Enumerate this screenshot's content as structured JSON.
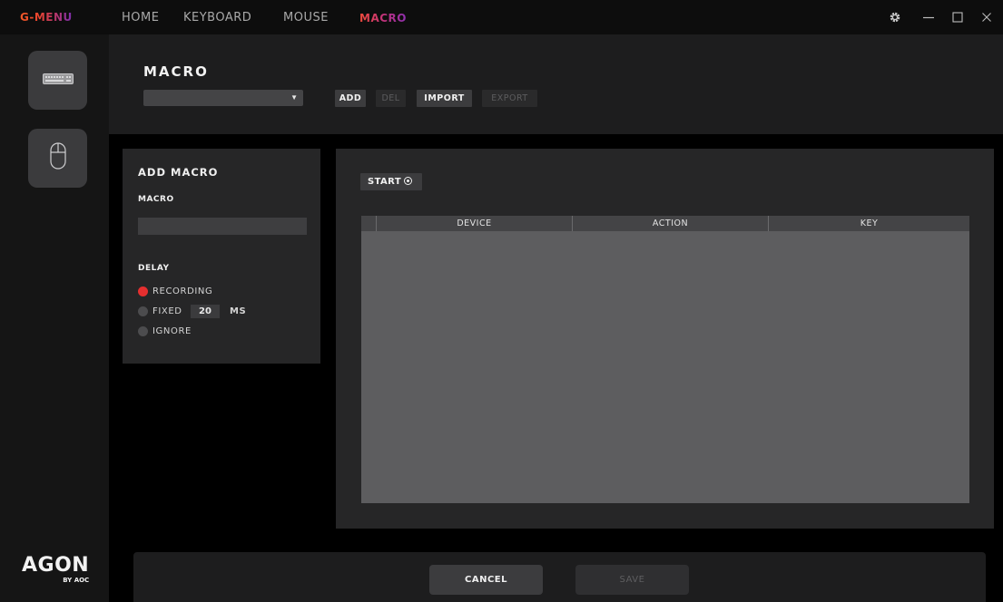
{
  "app": {
    "brand": "G-MENU"
  },
  "nav": {
    "items": [
      "HOME",
      "KEYBOARD",
      "MOUSE",
      "MACRO"
    ],
    "active": "MACRO"
  },
  "window_controls": {
    "settings": "gear-icon",
    "minimize": "minimize-icon",
    "maximize": "maximize-icon",
    "close": "close-icon"
  },
  "sidebar": {
    "devices": [
      {
        "name": "keyboard-icon"
      },
      {
        "name": "mouse-icon"
      }
    ]
  },
  "logo": {
    "main": "AGON",
    "sub": "BY AOC"
  },
  "header": {
    "title": "MACRO",
    "select_value": "",
    "buttons": {
      "add": "ADD",
      "del": "DEL",
      "import": "IMPORT",
      "export": "EXPORT"
    }
  },
  "add_macro": {
    "title": "ADD MACRO",
    "macro_label": "MACRO",
    "macro_value": "",
    "delay_label": "DELAY",
    "options": {
      "recording": "RECORDING",
      "fixed": "FIXED",
      "ignore": "IGNORE"
    },
    "selected": "RECORDING",
    "fixed_value": "20",
    "fixed_unit": "MS"
  },
  "recorder": {
    "start_label": "START",
    "columns": [
      "DEVICE",
      "ACTION",
      "KEY"
    ],
    "rows": []
  },
  "footer": {
    "cancel": "CANCEL",
    "save": "SAVE"
  },
  "colors": {
    "accent_red": "#e52f2f",
    "brand_orange": "#f05a28",
    "brand_purple": "#8e2fb0"
  }
}
